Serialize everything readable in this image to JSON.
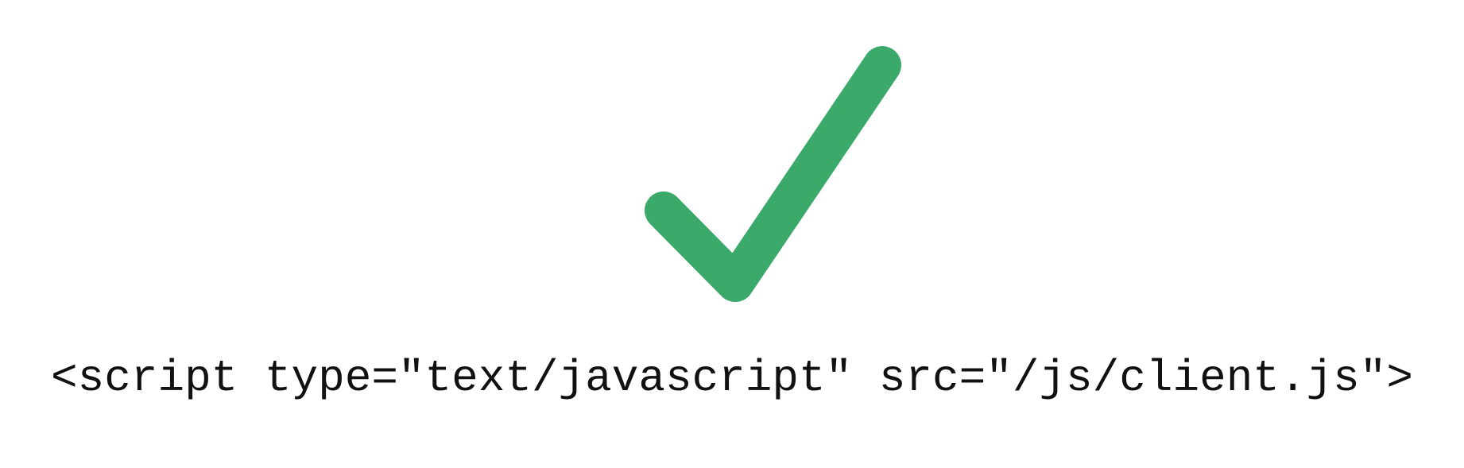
{
  "icon": {
    "name": "checkmark-icon",
    "color": "#3aa96a"
  },
  "code": {
    "text": "<script type=\"text/javascript\" src=\"/js/client.js\">"
  }
}
